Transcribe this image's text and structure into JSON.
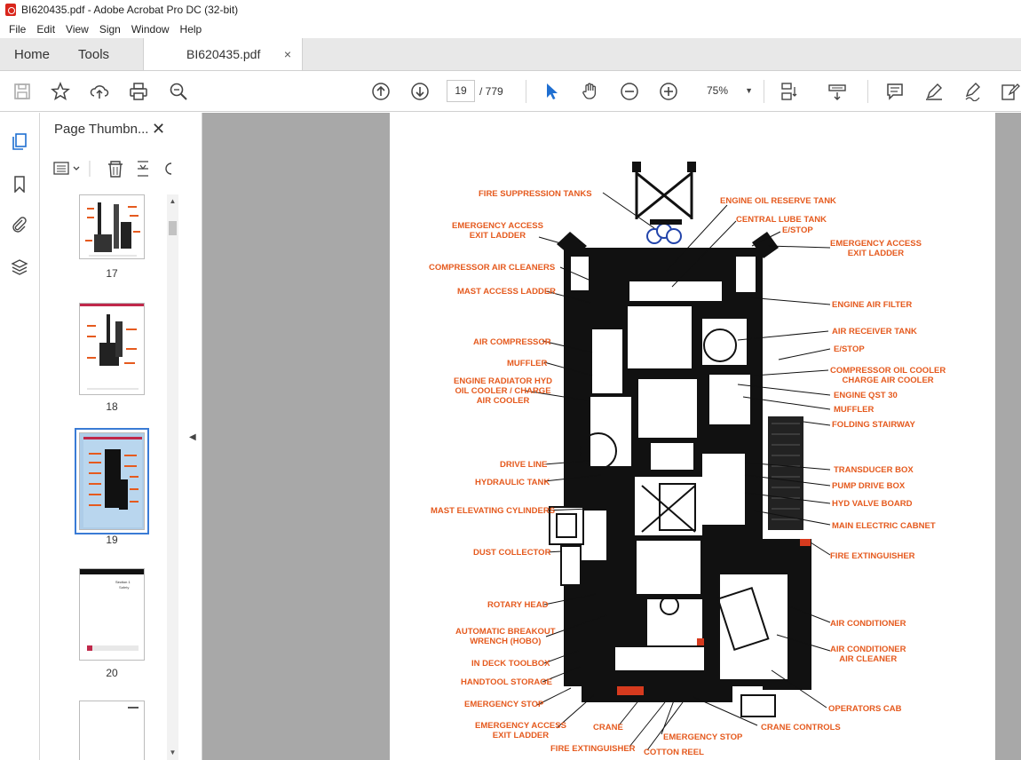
{
  "window": {
    "title": "BI620435.pdf - Adobe Acrobat Pro DC (32-bit)"
  },
  "menu": [
    "File",
    "Edit",
    "View",
    "Sign",
    "Window",
    "Help"
  ],
  "tabs": {
    "home": "Home",
    "tools": "Tools",
    "document": "BI620435.pdf",
    "close_symbol": "×"
  },
  "toolbar": {
    "current_page": "19",
    "page_total": "/ 779",
    "zoom": "75%"
  },
  "panel": {
    "header": "Page Thumbn...",
    "close_symbol": "✕"
  },
  "thumbnails": [
    {
      "label": "17"
    },
    {
      "label": "18"
    },
    {
      "label": "19"
    },
    {
      "label": "20"
    }
  ],
  "thumb20": {
    "heading": "Section 1",
    "subheading": "Safety"
  },
  "diagram": {
    "callouts_left": [
      "FIRE SUPPRESSION TANKS",
      "EMERGENCY ACCESS\nEXIT LADDER",
      "COMPRESSOR AIR CLEANERS",
      "MAST ACCESS LADDER",
      "AIR COMPRESSOR",
      "MUFFLER",
      "ENGINE RADIATOR HYD\nOIL COOLER / CHARGE\nAIR COOLER",
      "DRIVE LINE",
      "HYDRAULIC TANK",
      "MAST ELEVATING CYLINDERS",
      "DUST COLLECTOR",
      "ROTARY HEAD",
      "AUTOMATIC BREAKOUT\nWRENCH (HOBO)",
      "IN DECK TOOLBOX",
      "HANDTOOL STORAGE",
      "EMERGENCY STOP",
      "EMERGENCY ACCESS\nEXIT LADDER"
    ],
    "callouts_right": [
      "ENGINE OIL RESERVE TANK",
      "CENTRAL LUBE TANK",
      "E/STOP",
      "EMERGENCY ACCESS\nEXIT LADDER",
      "ENGINE AIR FILTER",
      "AIR RECEIVER TANK",
      "E/STOP",
      "COMPRESSOR OIL COOLER\nCHARGE AIR COOLER",
      "ENGINE QST 30",
      "MUFFLER",
      "FOLDING STAIRWAY",
      "TRANSDUCER BOX",
      "PUMP DRIVE BOX",
      "HYD VALVE BOARD",
      "MAIN ELECTRIC CABNET",
      "FIRE EXTINGUISHER",
      "AIR CONDITIONER",
      "AIR CONDITIONER\nAIR CLEANER",
      "OPERATORS CAB",
      "CRANE CONTROLS"
    ],
    "callouts_bottom": [
      "CRANE",
      "EMERGENCY STOP",
      "FIRE EXTINGUISHER",
      "COTTON REEL"
    ]
  },
  "colors": {
    "callout": "#e55a1e",
    "viewer_bg": "#a8a8a8",
    "accent": "#3a7bd5"
  }
}
